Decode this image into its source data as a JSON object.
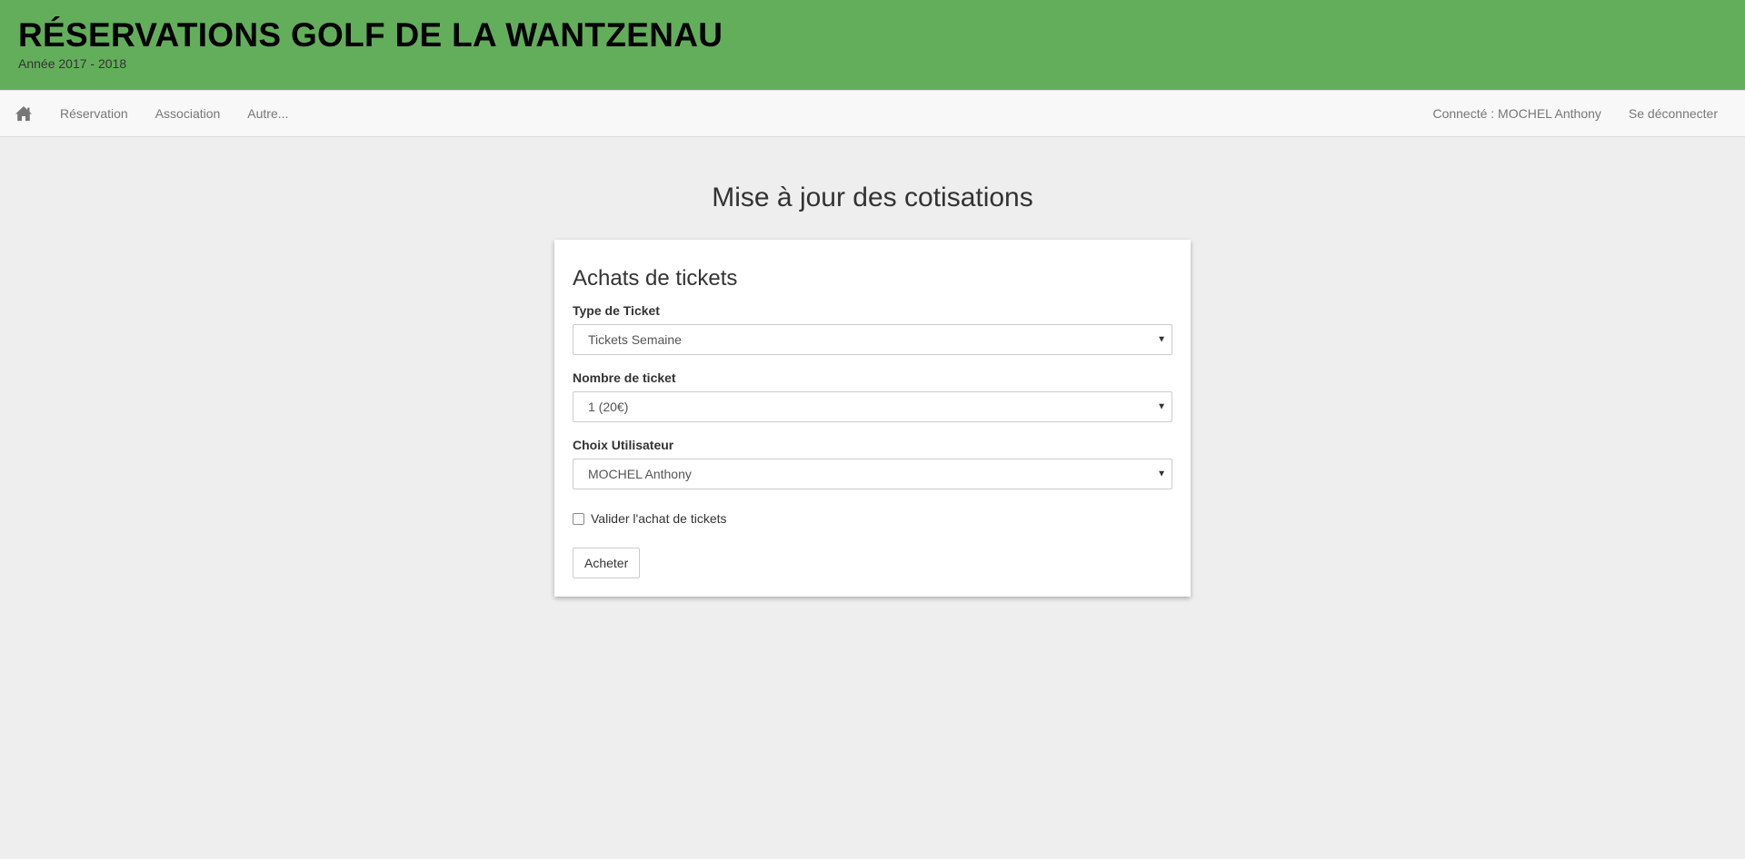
{
  "header": {
    "title": "RÉSERVATIONS GOLF DE LA WANTZENAU",
    "subtitle": "Année 2017 - 2018",
    "bg_color": "#63ae5b"
  },
  "navbar": {
    "home_icon": "home-icon",
    "links": [
      {
        "label": "Réservation"
      },
      {
        "label": "Association"
      },
      {
        "label": "Autre..."
      }
    ],
    "user_status": "Connecté : MOCHEL Anthony",
    "logout_label": "Se déconnecter"
  },
  "main": {
    "page_title": "Mise à jour des cotisations",
    "card": {
      "title": "Achats de tickets",
      "fields": [
        {
          "label": "Type de Ticket",
          "value": "Tickets Semaine"
        },
        {
          "label": "Nombre de ticket",
          "value": "1 (20€)"
        },
        {
          "label": "Choix Utilisateur",
          "value": "MOCHEL Anthony"
        }
      ],
      "checkbox_label": "Valider l'achat de tickets",
      "checkbox_checked": false,
      "submit_label": "Acheter"
    }
  }
}
